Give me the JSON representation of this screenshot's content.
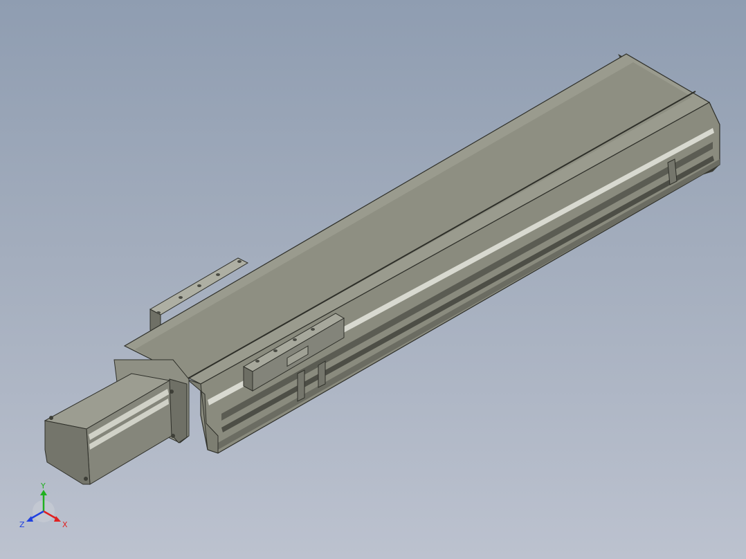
{
  "viewport": {
    "background_top": "#8f9db1",
    "background_bottom": "#bcc2cf"
  },
  "model": {
    "body_color": "#8a8b7e",
    "top_color": "#9a9b8e",
    "edge_color": "#2e2f29",
    "highlight_color": "#d8d9d0"
  },
  "triad": {
    "x_label": "X",
    "y_label": "Y",
    "z_label": "Z",
    "x_color": "#e02020",
    "y_color": "#20b020",
    "z_color": "#2040e0"
  }
}
